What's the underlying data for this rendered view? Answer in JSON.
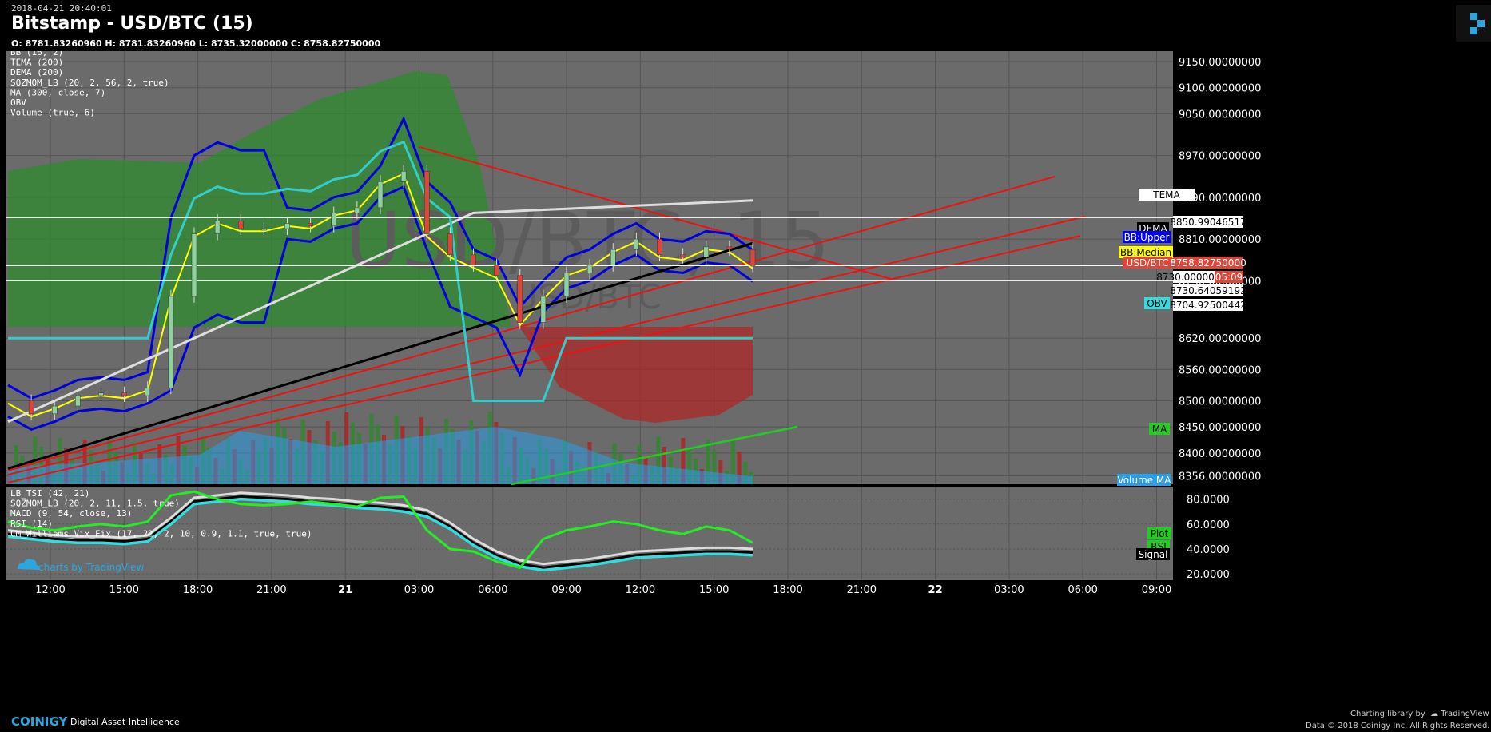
{
  "header": {
    "timestamp": "2018-04-21 20:40:01",
    "title": "Bitstamp - USD/BTC (15)",
    "ohlc": "O: 8781.83260960 H: 8781.83260960 L: 8735.32000000 C: 8758.82750000",
    "watermark": "USD/BTC, 15",
    "watermark_small": "USD/BTC"
  },
  "indicators_main": [
    "BB (16, 2)",
    "TEMA (200)",
    "DEMA (200)",
    "SQZMOM_LB (20, 2, 56, 2, true)",
    "MA (300, close, 7)",
    "OBV",
    "Volume (true, 6)"
  ],
  "indicators_sub": [
    "LB_TSI (42, 21)",
    "SQZMOM_LB (20, 2, 11, 1.5, true)",
    "MACD (9, 54, close, 13)",
    "RSI (14)",
    "CM_Williams_Vix_Fix (17, 22, 2, 10, 0.9, 1.1, true, true)"
  ],
  "tradingview_label": "charts by TradingView",
  "price_labels": [
    {
      "text": "TEMA",
      "color": "#ffffff",
      "fg": "#000000"
    },
    {
      "text": "8850.99046517",
      "color": "#ffffff",
      "fg": "#000000"
    },
    {
      "text": "DEMA",
      "color": "#000000",
      "fg": "#ffffff"
    },
    {
      "text": "BB:Upper",
      "color": "#0000ff",
      "fg": "#ffffff"
    },
    {
      "text": "BB:Median",
      "color": "#ffff00",
      "fg": "#000000"
    },
    {
      "text": "USD/BTC",
      "color": "#e0453a",
      "fg": "#ffffff"
    },
    {
      "text": "8758.82750000",
      "color": "#e0453a",
      "fg": "#ffffff"
    },
    {
      "text": "8730.00000000",
      "color": "#ffffff",
      "fg": "#000000"
    },
    {
      "text": "05:09",
      "color": "#e0453a",
      "fg": "#ffffff"
    },
    {
      "text": "8730.64059192",
      "color": "#ffffff",
      "fg": "#000000"
    },
    {
      "text": "OBV",
      "color": "#33dddd",
      "fg": "#000000"
    },
    {
      "text": "8704.92500442",
      "color": "#ffffff",
      "fg": "#000000"
    },
    {
      "text": "MA",
      "color": "#22cc22",
      "fg": "#000000"
    },
    {
      "text": "Volume MA",
      "color": "#2a9de8",
      "fg": "#ffffff"
    },
    {
      "text": "Plot",
      "color": "#22cc22",
      "fg": "#000000"
    },
    {
      "text": "RSI",
      "color": "#22cc22",
      "fg": "#000000"
    },
    {
      "text": "Signal",
      "color": "#000000",
      "fg": "#ffffff"
    }
  ],
  "footer": {
    "brand": "COINIGY",
    "tagline": "Digital Asset Intelligence",
    "charting": "Charting library by",
    "tv": "TradingView",
    "copyright": "Data © 2018 Coinigy Inc. All Rights Reserved."
  },
  "colors": {
    "bg": "#6b6b6b",
    "up_candle": "#8fd19e",
    "down_candle": "#e0453a",
    "bb": "#0000dd",
    "tema": "#dddddd",
    "dema": "#000000",
    "obv": "#33cccc",
    "trend": "#ee1111",
    "ma": "#22cc22"
  },
  "chart_data": {
    "type": "line",
    "title": "Bitstamp - USD/BTC (15)",
    "x_ticks": [
      "12:00",
      "15:00",
      "18:00",
      "21:00",
      "21",
      "03:00",
      "06:00",
      "09:00",
      "12:00",
      "15:00",
      "18:00",
      "21:00",
      "22",
      "03:00",
      "06:00",
      "09:00"
    ],
    "y_ticks": [
      9150,
      9100,
      9050,
      8970,
      8890,
      8810,
      8730,
      8620,
      8560,
      8500,
      8450,
      8400,
      8356
    ],
    "y_tick_labels": [
      "9150.00000000",
      "9100.00000000",
      "9050.00000000",
      "8970.00000000",
      "8890.00000000",
      "8810.00000000",
      "8730.00000000",
      "8620.00000000",
      "8560.00000000",
      "8500.00000000",
      "8450.00000000",
      "8400.00000000",
      "8356.00000000"
    ],
    "ylim": [
      8340,
      9170
    ],
    "last_close": 8758.8275,
    "close_series": {
      "x": [
        "12:00",
        "13:00",
        "14:00",
        "15:00",
        "16:00",
        "17:00",
        "18:00",
        "18:30",
        "19:00",
        "20:00",
        "21:00",
        "22:00",
        "23:00",
        "00:00",
        "01:00",
        "02:00",
        "03:00",
        "03:30",
        "04:00",
        "05:00",
        "06:00",
        "07:00",
        "07:30",
        "08:00",
        "09:00",
        "10:00",
        "11:00",
        "12:00",
        "13:00",
        "14:00",
        "15:00",
        "16:00",
        "16:15"
      ],
      "close": [
        8500,
        8475,
        8490,
        8510,
        8515,
        8510,
        8525,
        8700,
        8820,
        8845,
        8830,
        8830,
        8840,
        8835,
        8860,
        8870,
        8920,
        8940,
        8820,
        8780,
        8760,
        8740,
        8650,
        8700,
        8745,
        8760,
        8790,
        8810,
        8780,
        8775,
        8795,
        8790,
        8758.83
      ]
    },
    "sub_panel": {
      "y_ticks": [
        80,
        60,
        40,
        20
      ],
      "y_tick_labels": [
        "80.0000",
        "60.0000",
        "40.0000",
        "20.0000"
      ],
      "ylim": [
        15,
        90
      ],
      "rsi": [
        62,
        57,
        55,
        58,
        60,
        58,
        62,
        83,
        86,
        80,
        76,
        75,
        76,
        78,
        76,
        74,
        81,
        82,
        55,
        40,
        38,
        30,
        25,
        48,
        55,
        58,
        62,
        60,
        55,
        52,
        58,
        55,
        45
      ],
      "signal": [
        52,
        50,
        48,
        47,
        47,
        46,
        48,
        62,
        78,
        80,
        82,
        81,
        80,
        78,
        77,
        75,
        74,
        72,
        68,
        58,
        45,
        35,
        28,
        25,
        27,
        29,
        32,
        35,
        36,
        37,
        38,
        38,
        37
      ]
    }
  }
}
